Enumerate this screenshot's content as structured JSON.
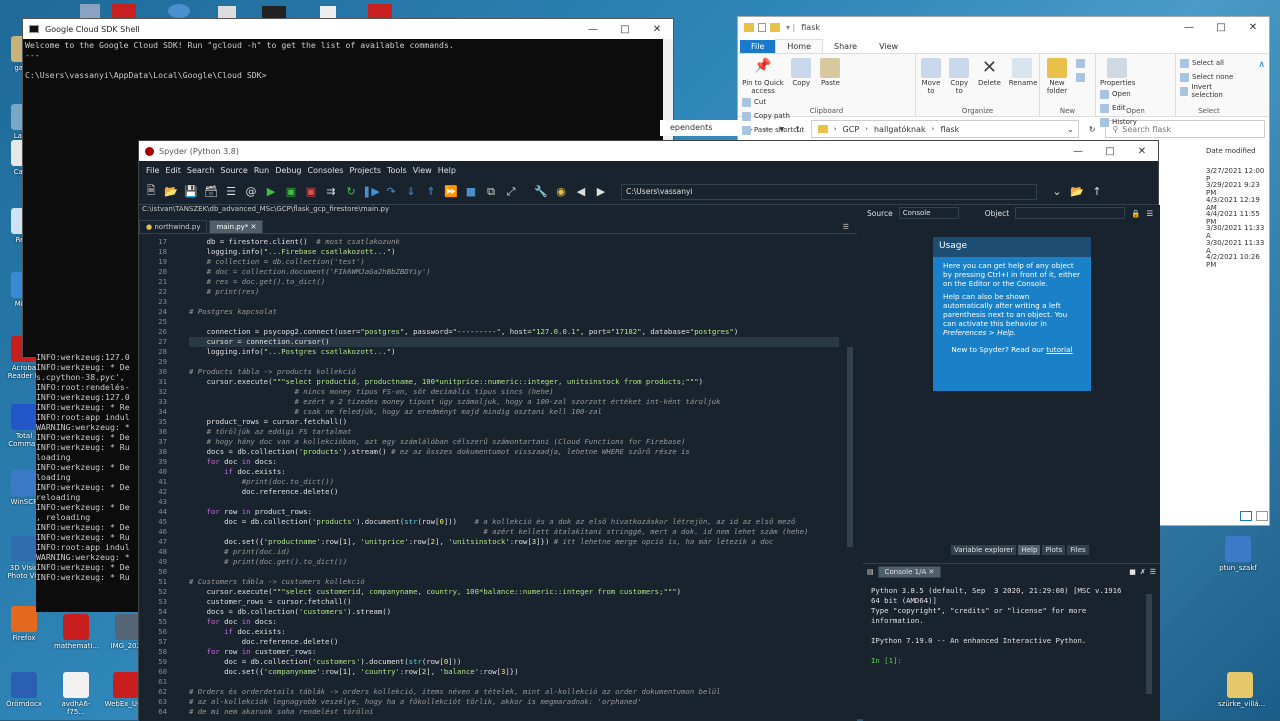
{
  "desktop": {
    "icons": [
      {
        "label": "galeo",
        "color": "#c8b37a"
      },
      {
        "label": "Lazeo Image",
        "color": "#7aa6c8"
      },
      {
        "label": "Captu",
        "color": "#e7e7e7"
      },
      {
        "label": "Recy",
        "color": "#cfe3f2"
      },
      {
        "label": "Mic E",
        "color": "#3b8ad8"
      },
      {
        "label": "Acroba Reader D",
        "color": "#c81e1e"
      },
      {
        "label": "Total Comman",
        "color": "#2356c8"
      },
      {
        "label": "WinSCP",
        "color": "#3a7ac6"
      },
      {
        "label": "3D Visio Photo Vie",
        "color": "#2f6cb0"
      },
      {
        "label": "Firefox",
        "color": "#e66a1e"
      },
      {
        "label": "mathemati...",
        "color": "#c81e1e"
      },
      {
        "label": "IMG_2020",
        "color": "#556677"
      },
      {
        "label": "Örömdocx",
        "color": "#2b5fb4"
      },
      {
        "label": "avdhA6-f75...",
        "color": "#f2f2f2"
      },
      {
        "label": "WebEx_Us...",
        "color": "#c81e1e"
      },
      {
        "label": "ptun_szakf",
        "color": "#3a7ac6"
      },
      {
        "label": "szürke_villá...",
        "color": "#e6c86a"
      }
    ]
  },
  "cmd": {
    "title": "Google Cloud SDK Shell",
    "lines": [
      "Welcome to the Google Cloud SDK! Run \"gcloud -h\" to get the list of available commands.",
      "---",
      "",
      "C:\\Users\\vassanyi\\AppData\\Local\\Google\\Cloud SDK>"
    ]
  },
  "log": {
    "lines": [
      "INFO:werkzeug:127.0",
      "INFO:werkzeug: * De",
      "s.cpython-38.pyc',",
      "INFO:root:rendelés-",
      "INFO:werkzeug:127.0",
      "INFO:werkzeug: * Re",
      "INFO:root:app indul",
      "WARNING:werkzeug: *",
      "INFO:werkzeug: * De",
      "INFO:werkzeug: * Ru",
      "loading",
      "INFO:werkzeug: * De",
      "loading",
      "INFO:werkzeug: * De",
      "reloading",
      "INFO:werkzeug: * De",
      ", reloading",
      "INFO:werkzeug: * De",
      "INFO:werkzeug: * Ru",
      "INFO:root:app indul",
      "WARNING:werkzeug: *",
      "INFO:werkzeug: * De",
      "INFO:werkzeug: * Ru"
    ]
  },
  "explorer": {
    "title": "flask",
    "tabs": [
      "File",
      "Home",
      "Share",
      "View"
    ],
    "clipboard": {
      "pin": "Pin to Quick access",
      "copy": "Copy",
      "paste": "Paste",
      "cut": "Cut",
      "copy_path": "Copy path",
      "paste_shortcut": "Paste shortcut",
      "label": "Clipboard"
    },
    "organize": {
      "move": "Move to",
      "copy": "Copy to",
      "delete": "Delete",
      "rename": "Rename",
      "label": "Organize"
    },
    "new": {
      "folder": "New folder",
      "label": "New"
    },
    "open": {
      "properties": "Properties",
      "open": "Open",
      "edit": "Edit",
      "history": "History",
      "label": "Open"
    },
    "select": {
      "all": "Select all",
      "none": "Select none",
      "invert": "Invert selection",
      "label": "Select"
    },
    "breadcrumb": [
      "GCP",
      "hallgatóknak",
      "flask"
    ],
    "search_placeholder": "Search flask",
    "date_header": "Date modified",
    "dates": [
      "3/27/2021 12:00 P",
      "3/29/2021 9:23 PM",
      "4/3/2021 12:19 AM",
      "4/4/2021 11:55 PM",
      "3/30/2021 11:33 A",
      "3/30/2021 11:33 A",
      "4/2/2021 10:26 PM"
    ],
    "dependents_tab": "ependents"
  },
  "spyder": {
    "title": "Spyder (Python 3.8)",
    "menu": [
      "File",
      "Edit",
      "Search",
      "Source",
      "Run",
      "Debug",
      "Consoles",
      "Projects",
      "Tools",
      "View",
      "Help"
    ],
    "cwd": "C:\\Users\\vassanyi",
    "file_path": "C:\\istvan\\TANSZEK\\db_advanced_MSc\\GCP\\flask_gcp_firestore\\main.py",
    "tabs": [
      "northwind.py",
      "main.py*"
    ],
    "line_start": 17,
    "code": [
      "    db = firestore.client()  # most csatlakozunk",
      "    logging.info(\"...Firebase csatlakozott...\")",
      "    # collection = db.collection('test')",
      "    # doc = collection.document('FIk6WMJaGa2hBbZBDYiy')",
      "    # res = doc.get().to_dict()",
      "    # print(res)",
      "",
      "# Postgres kapcsolat",
      "",
      "    connection = psycopg2.connect(user=\"postgres\", password=\"---------\", host=\"127.0.0.1\", port=\"17182\", database=\"postgres\")",
      "    cursor = connection.cursor()",
      "    logging.info(\"...Postgres csatlakozott...\")",
      "",
      "# Products tábla -> products kollekció",
      "    cursor.execute(\"\"\"select productid, productname, 100*unitprice::numeric::integer, unitsinstock from products;\"\"\")",
      "                        # nincs money típus FS-on, sőt decimális típus sincs (hehe)",
      "                        # ezért a 2 tizedes money típust úgy számoljuk, hogy a 100-zal szorzott értéket int-ként tároljuk",
      "                        # csak ne feledjük, hogy az eredményt majd mindig osztani kell 100-zal",
      "    product_rows = cursor.fetchall()",
      "    # töröljük az eddigi FS tartalmat",
      "    # hogy hány doc van a kollekcióban, azt egy számlálóban célszerű számontartani (Cloud Functions for Firebase)",
      "    docs = db.collection('products').stream() # ez az összes dokumentumot visszaadja, lehetne WHERE szűrő része is",
      "    for doc in docs:",
      "        if doc.exists:",
      "            #print(doc.to_dict())",
      "            doc.reference.delete()",
      "",
      "    for row in product_rows:",
      "        doc = db.collection('products').document(str(row[0]))    # a kollekció és a dok az első hivatkozáskor létrejön, az id az első mező",
      "                                                                   # azért kellett átalakítani stringgé, mert a dok. id nem lehet szám (hehe)",
      "        doc.set({'productname':row[1], 'unitprice':row[2], 'unitsinstock':row[3]}) # itt lehetne merge opció is, ha már létezik a doc",
      "        # print(doc.id)",
      "        # print(doc.get().to_dict())",
      "",
      "# Customers tábla -> customers kollekció",
      "    cursor.execute(\"\"\"select customerid, companyname, country, 100*balance::numeric::integer from customers;\"\"\")",
      "    customer_rows = cursor.fetchall()",
      "    docs = db.collection('customers').stream()",
      "    for doc in docs:",
      "        if doc.exists:",
      "            doc.reference.delete()",
      "    for row in customer_rows:",
      "        doc = db.collection('customers').document(str(row[0]))",
      "        doc.set({'companyname':row[1], 'country':row[2], 'balance':row[3]})",
      "",
      "# Orders és orderdetails táblák -> orders kollekció, items néven a tételek, mint al-kollekció az order dokumentumon belül",
      "# az al-kollekciók legnagyobb veszélye, hogy ha a főkollekciót törlik, akkor is megmaradnak: 'orphaned'",
      "# de mi nem akarunk soha rendelést törölni"
    ],
    "current_line": 27,
    "source_label": "Source",
    "source_value": "Console",
    "object_label": "Object",
    "usage": {
      "title": "Usage",
      "p1": "Here you can get help of any object by pressing Ctrl+I in front of it, either on the Editor or the Console.",
      "p2": "Help can also be shown automatically after writing a left parenthesis next to an object. You can activate this behavior in",
      "p2b": "Preferences > Help.",
      "p3": "New to Spyder? Read our",
      "p3link": "tutorial"
    },
    "pane_tabs": [
      "Variable explorer",
      "Help",
      "Plots",
      "Files"
    ],
    "console_tab": "Console 1/A",
    "console_lines": [
      "Python 3.8.5 (default, Sep  3 2020, 21:29:08) [MSC v.1916",
      "64 bit (AMD64)]",
      "Type \"copyright\", \"credits\" or \"license\" for more",
      "information.",
      "",
      "IPython 7.19.0 -- An enhanced Interactive Python.",
      ""
    ],
    "prompt": "In [1]:"
  }
}
